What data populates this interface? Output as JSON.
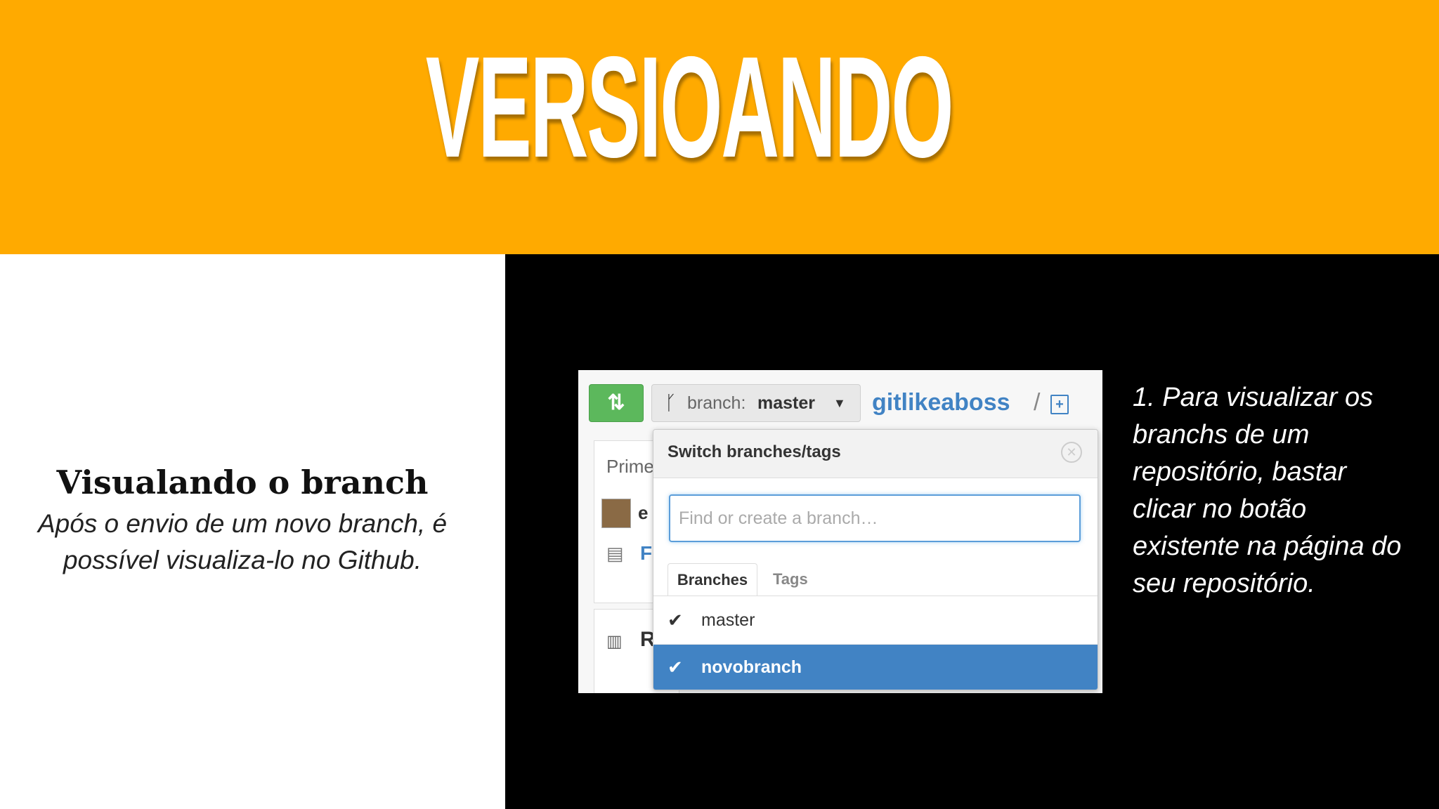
{
  "slide": {
    "title": "VERSIOANDO",
    "heading": "Visualando o branch",
    "body": "Após o envio de um novo branch, é possível visualiza-lo no Github.",
    "note": "1. Para visualizar os branchs de um repositório, bastar clicar no botão existente na página do seu repositório.",
    "colors": {
      "header_bg": "#FFAA00",
      "right_panel_bg": "#000000"
    }
  },
  "github": {
    "compare_icon": "compare-arrows-icon",
    "branch_icon": "git-branch-icon",
    "branch_label": "branch:",
    "branch_value": "master",
    "repo_name": "gitlikeaboss",
    "repo_separator": "/",
    "background_fragments": {
      "prime": "Prime",
      "e": "e",
      "f": "F",
      "r": "R"
    },
    "dropdown": {
      "title": "Switch branches/tags",
      "close_icon": "close-circle-icon",
      "search_placeholder": "Find or create a branch…",
      "tabs": [
        "Branches",
        "Tags"
      ],
      "branches": [
        {
          "name": "master",
          "checked": true,
          "selected": false
        },
        {
          "name": "novobranch",
          "checked": true,
          "selected": true
        }
      ],
      "colors": {
        "selected_row": "#4183C4",
        "repo_link": "#4183C4"
      }
    }
  }
}
